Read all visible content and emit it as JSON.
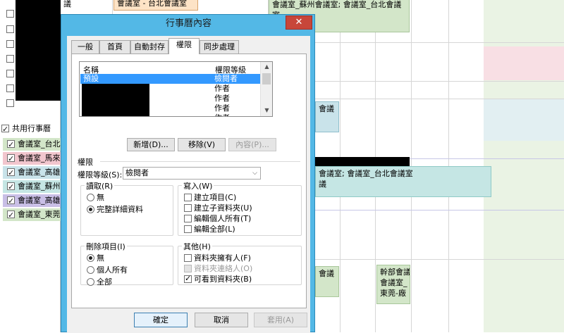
{
  "left_pane": {
    "shared_calendars_label": "共用行事曆",
    "calendars": [
      {
        "label": "會議室_台北",
        "checked": true,
        "color": "#d3e6c9"
      },
      {
        "label": "會議室_馬來",
        "checked": true,
        "color": "#f2c6ce"
      },
      {
        "label": "會議室_高雄",
        "checked": true,
        "color": "#c9e3ea"
      },
      {
        "label": "會議室_蘇州",
        "checked": true,
        "color": "#c5e6e4"
      },
      {
        "label": "會議室_高雄",
        "checked": true,
        "color": "#c9bfe6"
      },
      {
        "label": "會議室_東莞",
        "checked": true,
        "color": "#d3e6c9"
      }
    ]
  },
  "background_events": {
    "top_left_event": "會議室 - 台北會議室",
    "top_banner_line1": "會議室_蘇州會議室; 會議室_台北會議室",
    "top_banner_line2": "",
    "mid_short": "會議",
    "mid_banner_line1": "會議室; 會議室_台北會議室",
    "mid_banner_line2": "議",
    "bottom_short": "會議",
    "bottom_card_line1": "幹部會議",
    "bottom_card_line2": "會議室_",
    "bottom_card_line3": "東莞-廠",
    "top_stub": "議"
  },
  "dialog": {
    "title": "行事曆內容",
    "close_glyph": "✕",
    "tabs": [
      "一般",
      "首頁",
      "自動封存",
      "權限",
      "同步處理"
    ],
    "active_tab": "權限",
    "list": {
      "col_name": "名稱",
      "col_level": "權限等級",
      "rows": [
        {
          "name": "預設",
          "level": "檢閱者",
          "selected": true
        },
        {
          "name": "",
          "level": "作者"
        },
        {
          "name": "",
          "level": "作者"
        },
        {
          "name": "",
          "level": "作者"
        },
        {
          "name": "",
          "level": "作者"
        }
      ]
    },
    "add_button": "新增(D)...",
    "remove_button": "移除(V)",
    "properties_button": "內容(P)...",
    "permissions_label": "權限",
    "level_label": "權限等級(S):",
    "level_value": "檢閱者",
    "read_group": {
      "title": "讀取(R)",
      "options": [
        {
          "label": "無",
          "selected": false
        },
        {
          "label": "完整詳細資料",
          "selected": true
        }
      ]
    },
    "write_group": {
      "title": "寫入(W)",
      "options": [
        {
          "label": "建立項目(C)",
          "checked": false
        },
        {
          "label": "建立子資料夾(U)",
          "checked": false
        },
        {
          "label": "編輯個人所有(T)",
          "checked": false
        },
        {
          "label": "編輯全部(L)",
          "checked": false
        }
      ]
    },
    "delete_group": {
      "title": "刪除項目(I)",
      "options": [
        {
          "label": "無",
          "selected": true
        },
        {
          "label": "個人所有",
          "selected": false
        },
        {
          "label": "全部",
          "selected": false
        }
      ]
    },
    "other_group": {
      "title": "其他(H)",
      "options": [
        {
          "label": "資料夾擁有人(F)",
          "checked": false,
          "disabled": false
        },
        {
          "label": "資料夾連絡人(O)",
          "checked": false,
          "disabled": true
        },
        {
          "label": "可看到資料夾(B)",
          "checked": true,
          "disabled": false
        }
      ]
    },
    "ok_button": "確定",
    "cancel_button": "取消",
    "apply_button": "套用(A)"
  }
}
